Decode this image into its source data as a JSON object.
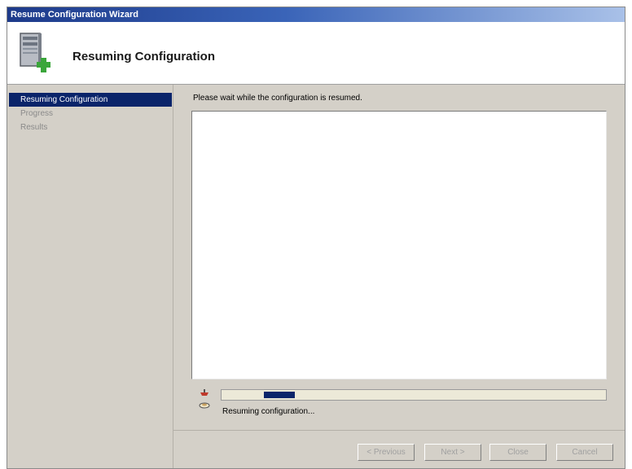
{
  "window": {
    "title": "Resume Configuration Wizard"
  },
  "header": {
    "title": "Resuming Configuration",
    "icon": "server-add-icon"
  },
  "sidebar": {
    "items": [
      {
        "label": "Resuming Configuration",
        "active": true
      },
      {
        "label": "Progress",
        "active": false
      },
      {
        "label": "Results",
        "active": false
      }
    ]
  },
  "main": {
    "instruction": "Please wait while the configuration is resumed.",
    "status_text": "Resuming configuration...",
    "progress_icon": "hourglass-icon"
  },
  "buttons": {
    "previous": "< Previous",
    "next": "Next >",
    "close": "Close",
    "cancel": "Cancel"
  },
  "colors": {
    "selection": "#0a246a",
    "title_gradient_start": "#1d3a8a",
    "title_gradient_end": "#a9c1e8"
  }
}
